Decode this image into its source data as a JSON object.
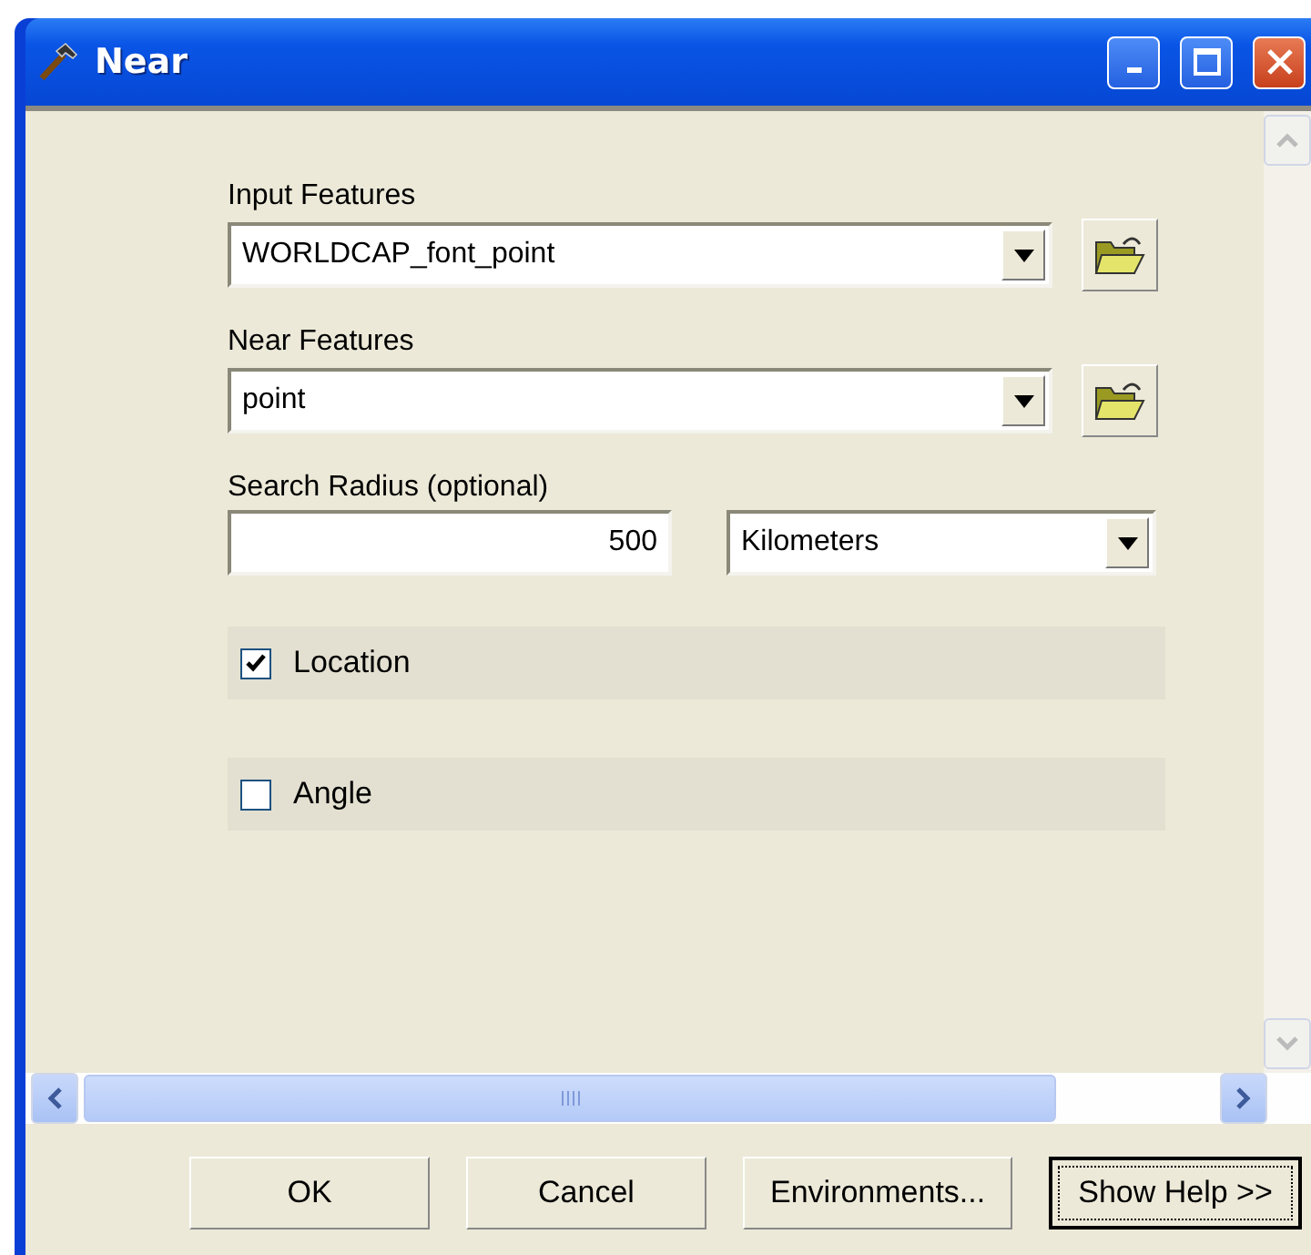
{
  "window": {
    "title": "Near"
  },
  "input_features": {
    "label": "Input Features",
    "value": "WORLDCAP_font_point"
  },
  "near_features": {
    "label": "Near Features",
    "value": "point"
  },
  "search_radius": {
    "label": "Search Radius (optional)",
    "value": "500",
    "unit": "Kilometers"
  },
  "options": [
    {
      "label": "Location",
      "checked": true
    },
    {
      "label": "Angle",
      "checked": false
    }
  ],
  "buttons": [
    {
      "label": "OK",
      "default": false
    },
    {
      "label": "Cancel",
      "default": false
    },
    {
      "label": "Environments...",
      "default": false
    },
    {
      "label": "Show Help >>",
      "default": true
    }
  ]
}
